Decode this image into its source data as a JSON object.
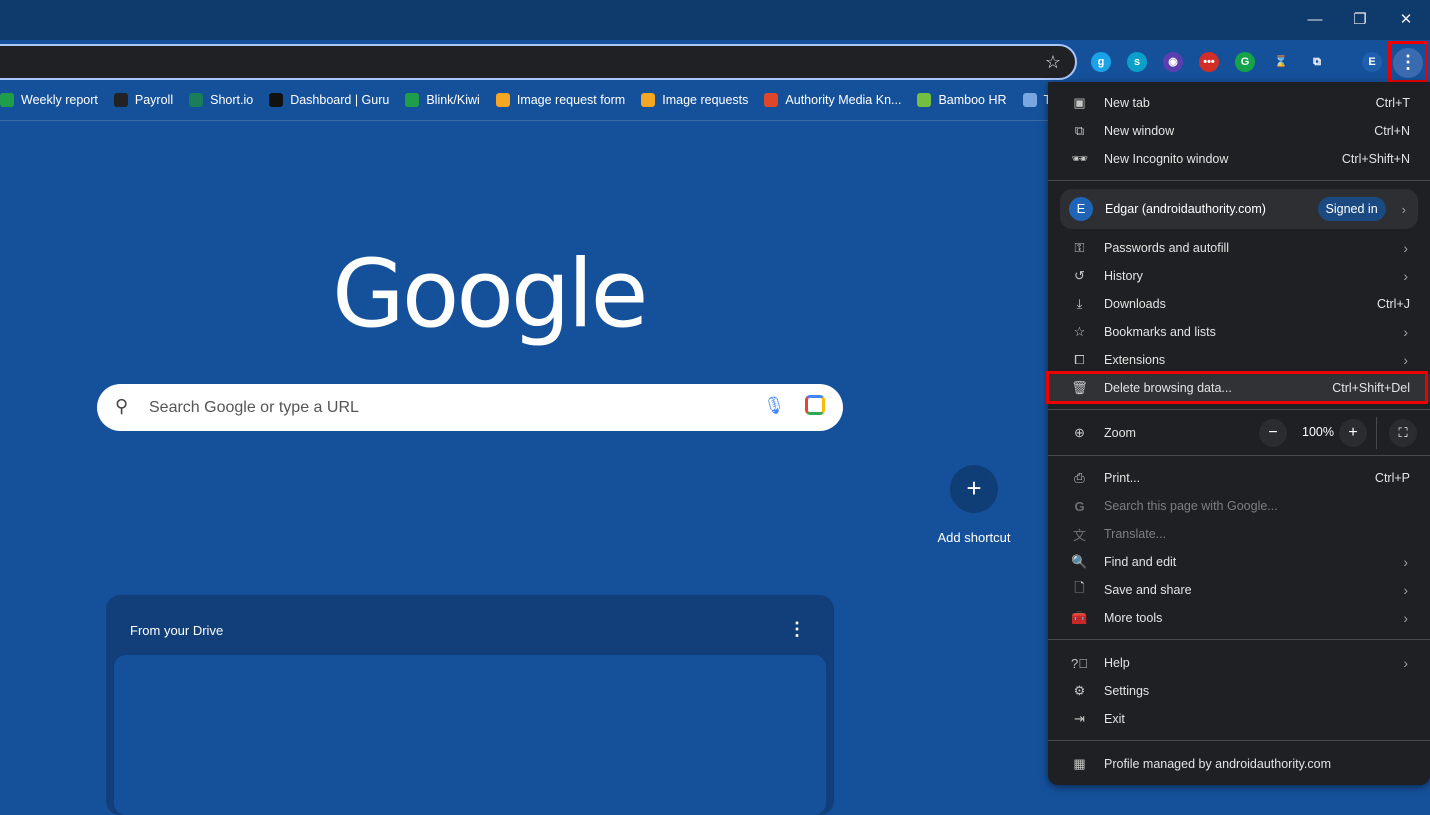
{
  "window": {
    "minimize": "—",
    "maximize": "❐",
    "close": "✕"
  },
  "toolbar": {
    "profile_initial": "E",
    "extensions": [
      {
        "name": "g",
        "color": "#1aa3e8",
        "glyph": "g"
      },
      {
        "name": "s",
        "color": "#0aa0c8",
        "glyph": "s"
      },
      {
        "name": "fingerprint",
        "color": "#5b3fb0",
        "glyph": "◉"
      },
      {
        "name": "lastpass",
        "color": "#d32d27",
        "glyph": "•••"
      },
      {
        "name": "grammarly",
        "color": "#15a34a",
        "glyph": "G"
      },
      {
        "name": "timer",
        "color": "#15519b",
        "glyph": "⌛"
      },
      {
        "name": "extensions",
        "color": "#15519b",
        "glyph": "⧉"
      }
    ]
  },
  "bookmarks": [
    {
      "label": "Weekly report",
      "color": "#1e9e4a"
    },
    {
      "label": "Payroll",
      "color": "#222"
    },
    {
      "label": "Short.io",
      "color": "#1a7e5a"
    },
    {
      "label": "Dashboard | Guru",
      "color": "#111"
    },
    {
      "label": "Blink/Kiwi",
      "color": "#1e9e4a"
    },
    {
      "label": "Image request form",
      "color": "#f5a623"
    },
    {
      "label": "Image requests",
      "color": "#f5a623"
    },
    {
      "label": "Authority Media Kn...",
      "color": "#e0462a"
    },
    {
      "label": "Bamboo HR",
      "color": "#73c041"
    },
    {
      "label": "Toolb",
      "color": "#7aa7e0"
    }
  ],
  "page": {
    "logo": "Google",
    "search_placeholder": "Search Google or type a URL",
    "add_shortcut": "Add shortcut",
    "drive_title": "From your Drive"
  },
  "menu": {
    "new_tab": "New tab",
    "new_tab_sc": "Ctrl+T",
    "new_window": "New window",
    "new_window_sc": "Ctrl+N",
    "incognito": "New Incognito window",
    "incognito_sc": "Ctrl+Shift+N",
    "profile_name": "Edgar (androidauthority.com)",
    "profile_initial": "E",
    "signed_in": "Signed in",
    "passwords": "Passwords and autofill",
    "history": "History",
    "downloads": "Downloads",
    "downloads_sc": "Ctrl+J",
    "bookmarks": "Bookmarks and lists",
    "extensions": "Extensions",
    "delete": "Delete browsing data...",
    "delete_sc": "Ctrl+Shift+Del",
    "zoom": "Zoom",
    "zoom_value": "100%",
    "print": "Print...",
    "print_sc": "Ctrl+P",
    "search_page": "Search this page with Google...",
    "translate": "Translate...",
    "find": "Find and edit",
    "save": "Save and share",
    "more_tools": "More tools",
    "help": "Help",
    "settings": "Settings",
    "exit": "Exit",
    "managed": "Profile managed by androidauthority.com"
  },
  "colors": {
    "highlight": "#ee0000",
    "page_bg": "#15519b",
    "menu_bg": "#1f2023"
  }
}
